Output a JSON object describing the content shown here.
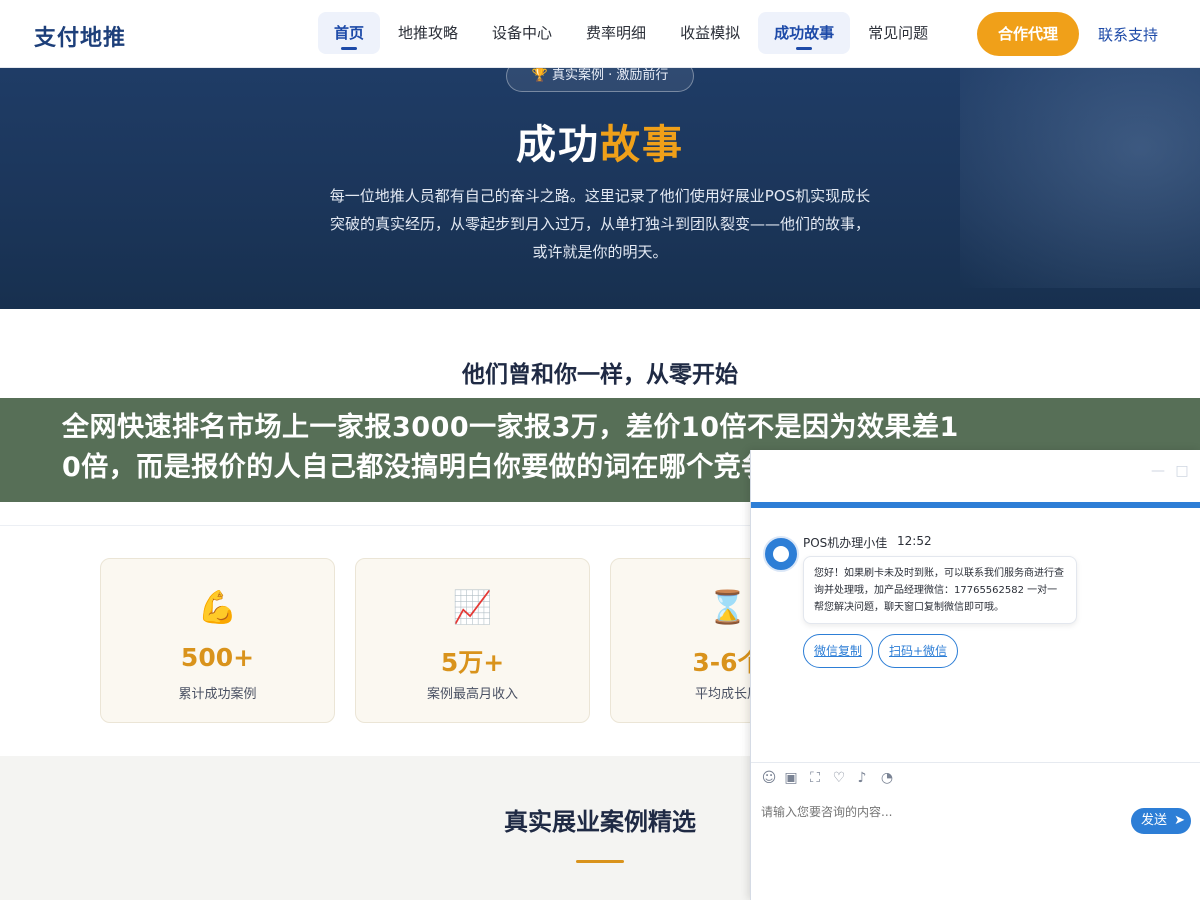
{
  "nav": {
    "logo": "支付地推",
    "items": [
      "首页",
      "地推攻略",
      "设备中心",
      "费率明细",
      "收益模拟",
      "成功故事",
      "常见问题"
    ],
    "cta": "合作代理",
    "support": "联系支持"
  },
  "hero": {
    "badge": "🏆 真实案例 · 激励前行",
    "title_main": "成功",
    "title_accent": "故事",
    "desc": "每一位地推人员都有自己的奋斗之路。这里记录了他们使用好展业POS机实现成长突破的真实经历，从零起步到月入过万，从单打独斗到团队裂变——他们的故事，或许就是你的明天。"
  },
  "section_intro": {
    "title": "他们曾和你一样，从零开始"
  },
  "stats": [
    {
      "icon": "💪",
      "value": "500+",
      "label": "累计成功案例"
    },
    {
      "icon": "📈",
      "value": "5万+",
      "label": "案例最高月收入"
    },
    {
      "icon": "⌛",
      "value": "3-6个",
      "label": "平均成长周"
    }
  ],
  "section_cases": {
    "title": "真实展业案例精选"
  },
  "banner": {
    "line1": "全网快速排名市场上一家报3000一家报3万，差价10倍不是因为效果差1",
    "line2": "0倍，而是报价的人自己都没搞明白你要做的词在哪个竞争梯队，同一个"
  },
  "chat": {
    "agent_name": "POS机办理小佳",
    "time": "12:52",
    "message": "您好！如果刷卡未及时到账，可以联系我们服务商进行查询并处理哦，加产品经理微信：17765562582 一对一帮您解决问题，聊天窗口复制微信即可哦。",
    "quick_replies": [
      "微信复制",
      "扫码+微信"
    ],
    "input_placeholder": "请输入您要咨询的内容...",
    "send": "发送",
    "toolbar_icons": [
      "emoji-icon",
      "image-icon",
      "screenshot-icon",
      "rating-icon",
      "voice-icon",
      "history-icon"
    ],
    "accent_color": "#2d7ed6"
  },
  "colors": {
    "brand": "#1d4aa8",
    "accent": "#f0a019",
    "hero_bg": "#1b3559"
  }
}
